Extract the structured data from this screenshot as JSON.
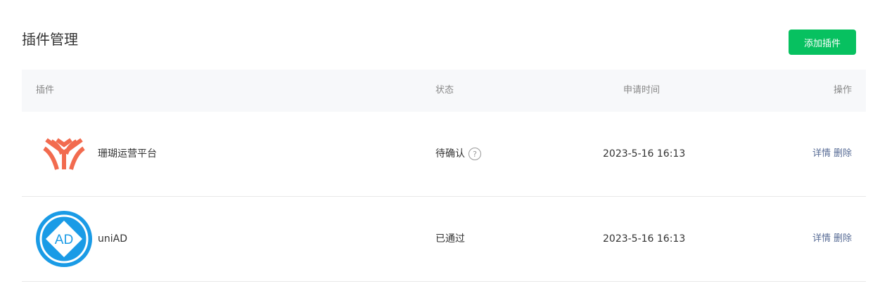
{
  "header": {
    "title": "插件管理",
    "add_button": "添加插件"
  },
  "table": {
    "columns": [
      "插件",
      "状态",
      "申请时间",
      "操作"
    ],
    "rows": [
      {
        "name": "珊瑚运营平台",
        "status": "待确认",
        "time": "2023-5-16 16:13",
        "detail": "详情",
        "delete": "删除",
        "icon": "coral-logo-icon"
      },
      {
        "name": "uniAD",
        "status": "已通过",
        "time": "2023-5-16 16:13",
        "detail": "详情",
        "delete": "删除",
        "icon": "uniad-logo-icon",
        "logo_text": "AD"
      }
    ]
  },
  "colors": {
    "accent": "#07c160",
    "link": "#576b95",
    "coral": "#f26b4f",
    "uniad_blue": "#1a9be6"
  }
}
